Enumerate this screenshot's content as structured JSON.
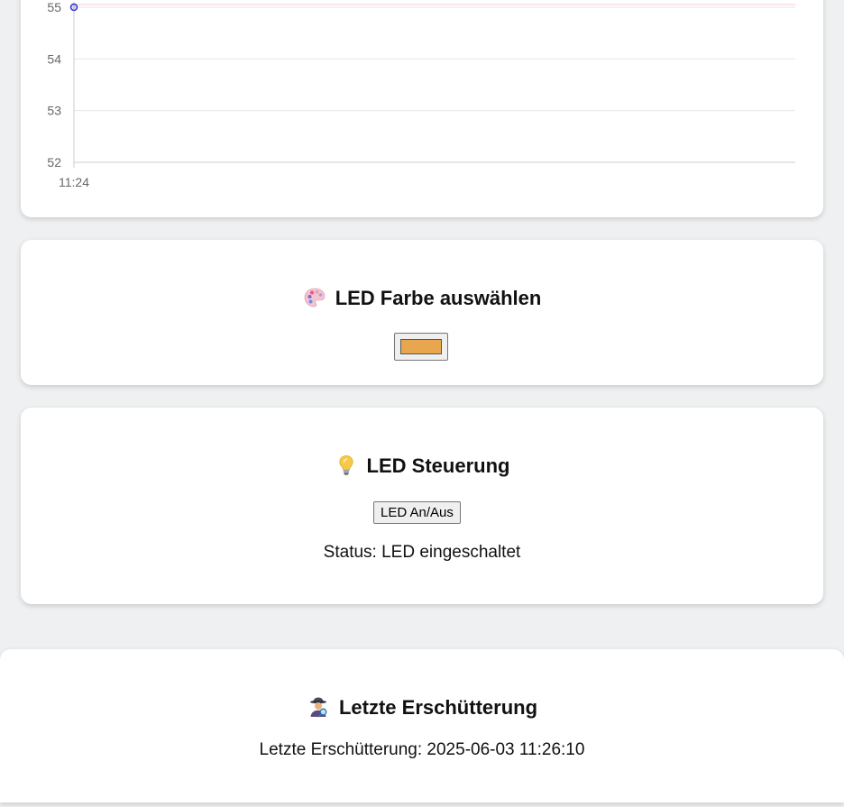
{
  "chart_data": {
    "type": "line",
    "x": [
      "11:24"
    ],
    "series": [
      {
        "values": [
          55
        ],
        "color": "#3333cc"
      }
    ],
    "y_ticks": [
      52,
      53,
      54,
      55
    ],
    "x_ticks": [
      "11:24"
    ],
    "ylim": [
      52,
      55
    ],
    "grid": true,
    "threshold_line_color": "#f3c7cf"
  },
  "color_picker": {
    "title": "LED Farbe auswählen",
    "icon": "palette-icon",
    "selected_color": "#e8a74e"
  },
  "led_control": {
    "title": "LED Steuerung",
    "icon": "lightbulb-icon",
    "toggle_label": "LED An/Aus",
    "status": "Status: LED eingeschaltet"
  },
  "shock": {
    "title": "Letzte Erschütterung",
    "icon": "detective-icon",
    "text": "Letzte Erschütterung: 2025-06-03 11:26:10"
  }
}
